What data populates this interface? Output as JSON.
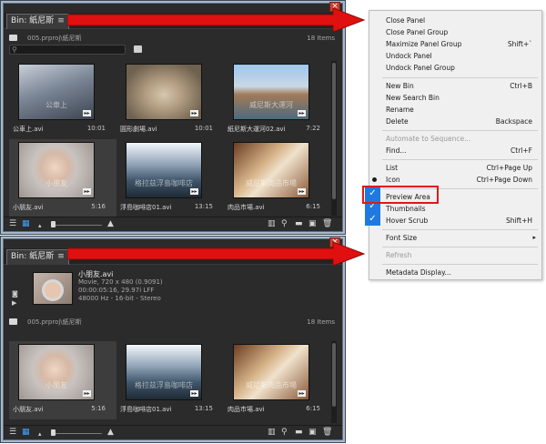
{
  "panel1": {
    "close_glyph": "×",
    "tab_label": "Bin: 紙尼斯",
    "tab_menu_glyph": "≡",
    "tab_close_glyph": "×",
    "path": "005.prproj\\紙尼斯",
    "item_count": "18 Items",
    "search_placeholder": "",
    "items": [
      {
        "name": "公車上.avi",
        "duration": "10:01",
        "watermark": "公車上"
      },
      {
        "name": "圓形劇場.avi",
        "duration": "10:01",
        "watermark": ""
      },
      {
        "name": "紙尼斯大運河02.avi",
        "duration": "7:22",
        "watermark": "威尼斯大運河"
      },
      {
        "name": "小朋友.avi",
        "duration": "5:16",
        "watermark": "小朋友"
      },
      {
        "name": "浮島咖啡店01.avi",
        "duration": "13:15",
        "watermark": "格拉茲浮島咖啡店"
      },
      {
        "name": "肉品市場.avi",
        "duration": "6:15",
        "watermark": "威尼斯肉品市場"
      }
    ]
  },
  "panel2": {
    "close_glyph": "×",
    "tab_label": "Bin: 紙尼斯",
    "tab_menu_glyph": "≡",
    "tab_close_glyph": "×",
    "preview": {
      "name": "小朋友.avi",
      "line1": "Movie, 720 x 480 (0.9091)",
      "line2": "00:00:05:16, 29.97i LFF",
      "line3": "48000 Hz - 16-bit - Stereo"
    },
    "path": "005.prproj\\紙尼斯",
    "item_count": "18 Items",
    "items": [
      {
        "name": "小朋友.avi",
        "duration": "5:16",
        "watermark": "小朋友"
      },
      {
        "name": "浮島咖啡店01.avi",
        "duration": "13:15",
        "watermark": "格拉茲浮島咖啡店"
      },
      {
        "name": "肉品市場.avi",
        "duration": "6:15",
        "watermark": "威尼斯肉品市場"
      }
    ]
  },
  "bottombar_icons": {
    "list": "☰",
    "icon": "▦",
    "zoom_small": "▴",
    "zoom_large": "▲",
    "automate": "▥",
    "find": "⚲",
    "new_bin": "▬",
    "new_item": "▣",
    "delete": "🗑"
  },
  "menu": {
    "items": [
      {
        "label": "Close Panel",
        "shortcut": ""
      },
      {
        "label": "Close Panel Group",
        "shortcut": ""
      },
      {
        "label": "Maximize Panel Group",
        "shortcut": "Shift+`"
      },
      {
        "label": "Undock Panel",
        "shortcut": ""
      },
      {
        "label": "Undock Panel Group",
        "shortcut": ""
      },
      {
        "label": "New Bin",
        "shortcut": "Ctrl+B"
      },
      {
        "label": "New Search Bin",
        "shortcut": ""
      },
      {
        "label": "Rename",
        "shortcut": ""
      },
      {
        "label": "Delete",
        "shortcut": "Backspace"
      },
      {
        "label": "Automate to Sequence...",
        "shortcut": ""
      },
      {
        "label": "Find...",
        "shortcut": "Ctrl+F"
      },
      {
        "label": "List",
        "shortcut": "Ctrl+Page Up"
      },
      {
        "label": "Icon",
        "shortcut": "Ctrl+Page Down"
      },
      {
        "label": "Preview Area",
        "shortcut": ""
      },
      {
        "label": "Thumbnails",
        "shortcut": ""
      },
      {
        "label": "Hover Scrub",
        "shortcut": "Shift+H"
      },
      {
        "label": "Font Size",
        "shortcut": ""
      },
      {
        "label": "Refresh",
        "shortcut": ""
      },
      {
        "label": "Metadata Display...",
        "shortcut": ""
      }
    ],
    "check_glyph": "✓",
    "submenu_glyph": "▸"
  },
  "colors": {
    "panel_bg": "#2b2b2b",
    "highlight_red": "#e01818",
    "check_blue": "#1f7ae0",
    "arrow_red": "#e01010"
  }
}
